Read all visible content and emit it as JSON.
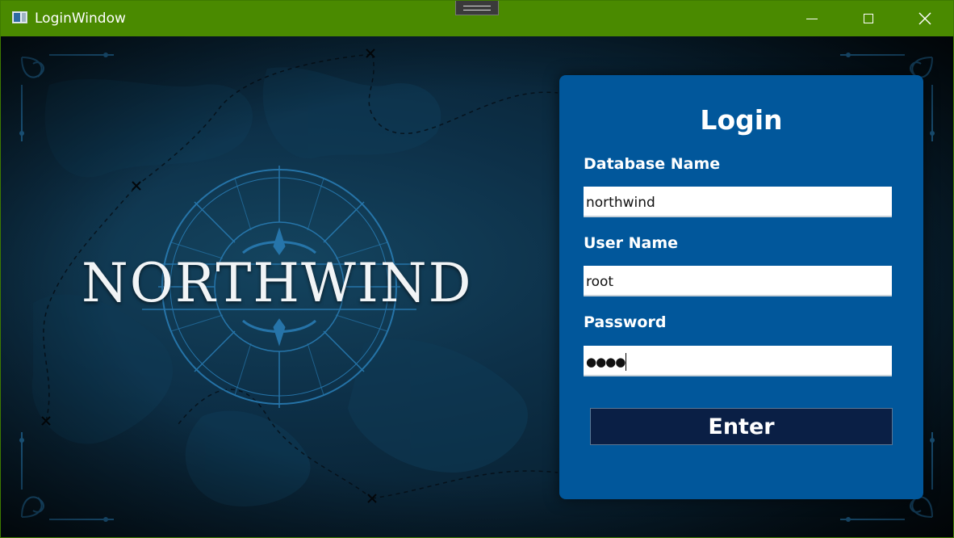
{
  "window": {
    "title": "LoginWindow",
    "accent_color": "#4a8a00",
    "icons": {
      "app": "app-window-icon",
      "minimize": "minimize-icon",
      "maximize": "maximize-icon",
      "close": "close-icon"
    }
  },
  "brand": {
    "logo_text": "NORTHWIND",
    "logo_color": "#f1f4f6",
    "emblem_color": "#2a7fb8",
    "decor_icons": [
      "compass-rose-icon",
      "corner-flourish-icon",
      "map-x-marker-icon"
    ]
  },
  "login": {
    "title": "Login",
    "panel_color": "#01579b",
    "fields": {
      "database": {
        "label": "Database Name",
        "value": "northwind"
      },
      "user": {
        "label": "User Name",
        "value": "root"
      },
      "password": {
        "label": "Password",
        "masked_value": "●●●●"
      }
    },
    "enter_label": "Enter",
    "enter_color": "#0a1f45"
  }
}
